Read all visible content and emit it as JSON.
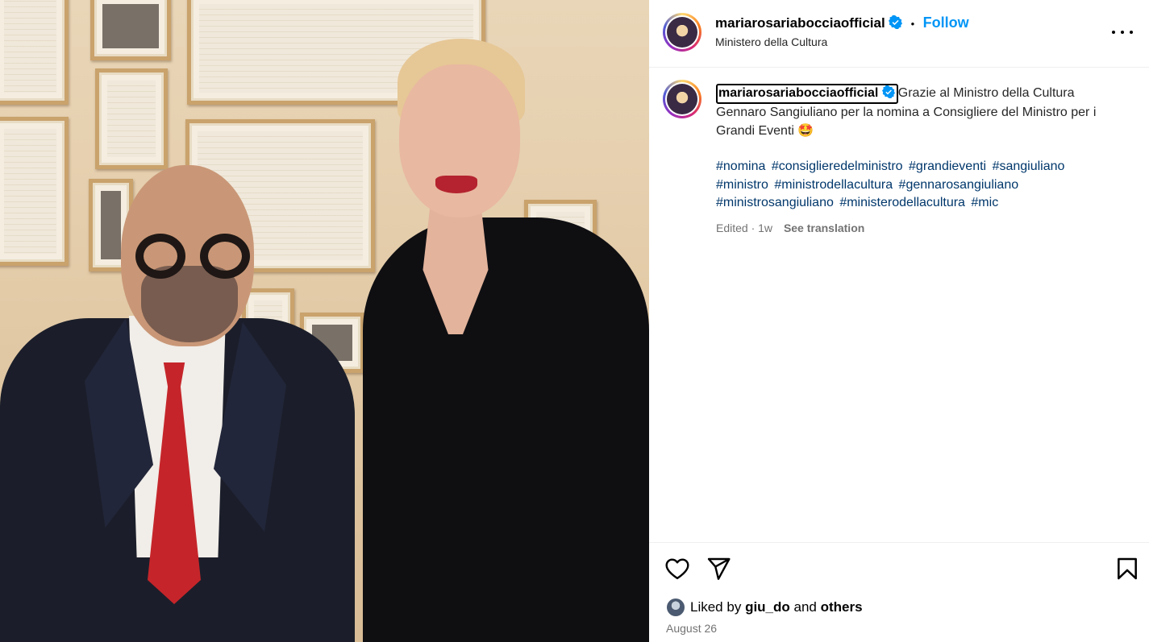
{
  "post": {
    "username": "mariarosariabocciaofficial",
    "dot": "•",
    "follow_label": "Follow",
    "location": "Ministero della Cultura",
    "caption": {
      "text": "Grazie al Ministro della Cultura Gennaro Sangiuliano per la nomina a Consigliere del Ministro per i Grandi Eventi 🤩",
      "hashtags": [
        "#nomina",
        "#consiglieredelministro",
        "#grandieventi",
        "#sangiuliano",
        "#ministro",
        "#ministrodellacultura",
        "#gennarosangiuliano",
        "#ministrosangiuliano",
        "#ministerodellacultura",
        "#mic"
      ],
      "edited_label": "Edited · 1w",
      "see_translation_label": "See translation"
    },
    "likes": {
      "prefix": "Liked by",
      "user": "giu_do",
      "joiner": "and",
      "others": "others"
    },
    "date": "August 26"
  },
  "icons": {
    "more": "more-options-icon",
    "verified": "verified-badge-icon",
    "like": "heart-icon",
    "share": "paper-plane-icon",
    "save": "bookmark-icon"
  },
  "colors": {
    "accent": "#0095f6",
    "verified": "#0095f6",
    "hashtag": "#00376b",
    "muted": "#737373"
  }
}
